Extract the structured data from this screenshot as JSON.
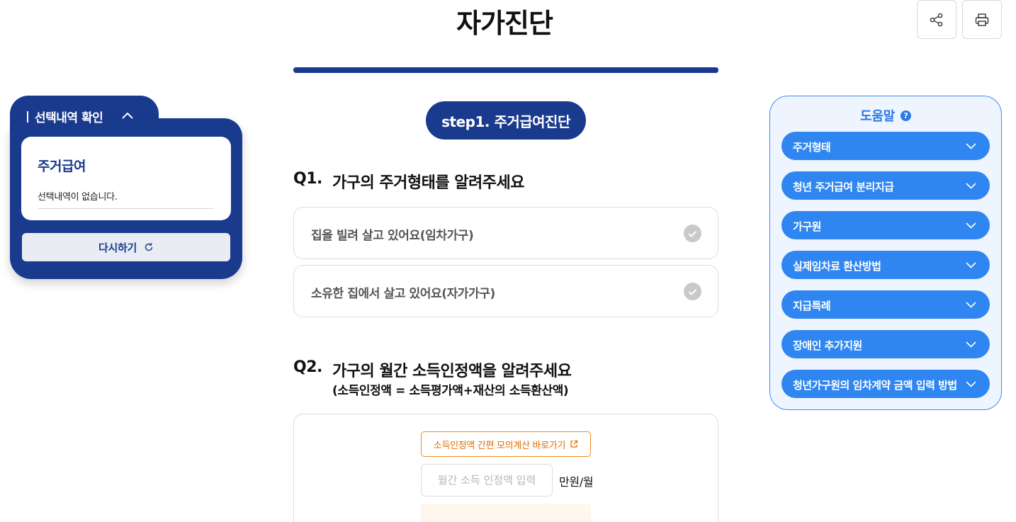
{
  "page": {
    "title": "자가진단"
  },
  "toolbar": {
    "share_icon": "share-icon",
    "print_icon": "print-icon"
  },
  "progress": {
    "value": 1.0,
    "color": "#1a3a8e"
  },
  "selection_panel": {
    "title": "선택내역 확인",
    "card_title": "주거급여",
    "empty_text": "선택내역이 없습니다.",
    "retry_label": "다시하기",
    "retry_icon": "refresh-icon",
    "color": "#1a3a8e"
  },
  "main": {
    "step_label": "step1. 주거급여진단",
    "q1": {
      "number": "Q1.",
      "title": "가구의 주거형태를 알려주세요",
      "options": [
        {
          "label": "집을 빌려 살고 있어요(임차가구)"
        },
        {
          "label": "소유한 집에서 살고 있어요(자가가구)"
        }
      ]
    },
    "q2": {
      "number": "Q2.",
      "title": "가구의 월간 소득인정액을 알려주세요",
      "subtitle": "(소득인정액 = 소득평가액+재산의 소득환산액)",
      "calc_link": "소득인정액 간편 모의계산 바로가기",
      "input_placeholder": "월간 소득 인정액 입력",
      "input_value": "",
      "unit": "만원/월"
    }
  },
  "help": {
    "title": "도움말",
    "items": [
      {
        "label": "주거형태"
      },
      {
        "label": "청년 주거급여 분리지급"
      },
      {
        "label": "가구원"
      },
      {
        "label": "실제임차료 환산방법"
      },
      {
        "label": "지급특례"
      },
      {
        "label": "장애인 추가지원"
      },
      {
        "label": "청년가구원의 임차계약 금액 입력 방법"
      }
    ],
    "accent": "#2f86f0"
  }
}
